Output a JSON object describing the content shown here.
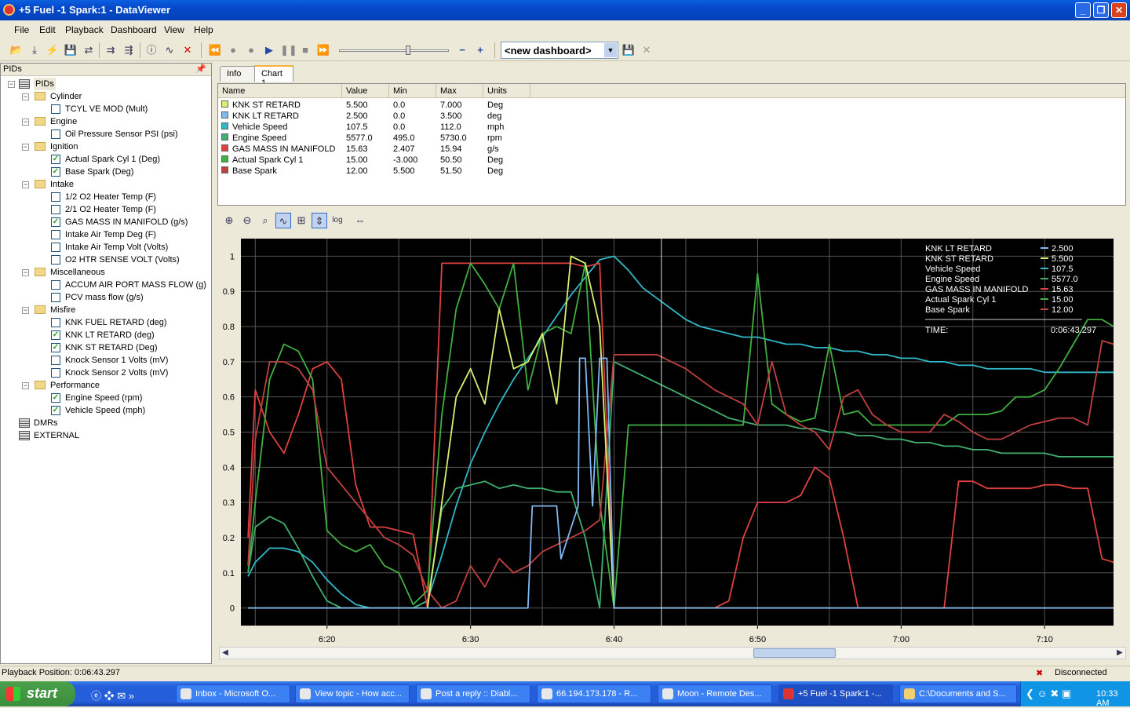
{
  "window": {
    "title": "+5 Fuel -1 Spark:1 - DataViewer"
  },
  "menu": [
    "File",
    "Edit",
    "Playback",
    "Dashboard",
    "View",
    "Help"
  ],
  "toolbar": {
    "dashboard_value": "<new dashboard>"
  },
  "pids_panel": {
    "title": "PIDs",
    "root": "PIDs",
    "groups": [
      {
        "name": "Cylinder",
        "items": [
          {
            "label": "TCYL VE MOD (Mult)",
            "checked": false
          }
        ]
      },
      {
        "name": "Engine",
        "items": [
          {
            "label": "Oil Pressure Sensor PSI (psi)",
            "checked": false
          }
        ]
      },
      {
        "name": "Ignition",
        "items": [
          {
            "label": "Actual Spark Cyl 1 (Deg)",
            "checked": true
          },
          {
            "label": "Base Spark (Deg)",
            "checked": true
          }
        ]
      },
      {
        "name": "Intake",
        "items": [
          {
            "label": "1/2 O2 Heater Temp (F)",
            "checked": false
          },
          {
            "label": "2/1 O2 Heater Temp (F)",
            "checked": false
          },
          {
            "label": "GAS MASS IN MANIFOLD (g/s)",
            "checked": true
          },
          {
            "label": "Intake Air Temp Deg (F)",
            "checked": false
          },
          {
            "label": "Intake Air Temp Volt (Volts)",
            "checked": false
          },
          {
            "label": "O2 HTR SENSE VOLT (Volts)",
            "checked": false
          }
        ]
      },
      {
        "name": "Miscellaneous",
        "items": [
          {
            "label": "ACCUM AIR PORT MASS FLOW (g)",
            "checked": false
          },
          {
            "label": "PCV mass flow (g/s)",
            "checked": false
          }
        ]
      },
      {
        "name": "Misfire",
        "items": [
          {
            "label": "KNK FUEL RETARD (deg)",
            "checked": false
          },
          {
            "label": "KNK LT RETARD (deg)",
            "checked": true
          },
          {
            "label": "KNK ST RETARD (Deg)",
            "checked": true
          },
          {
            "label": "Knock Sensor 1 Volts (mV)",
            "checked": false
          },
          {
            "label": "Knock Sensor 2 Volts (mV)",
            "checked": false
          }
        ]
      },
      {
        "name": "Performance",
        "items": [
          {
            "label": "Engine Speed (rpm)",
            "checked": true
          },
          {
            "label": "Vehicle Speed (mph)",
            "checked": true
          }
        ]
      }
    ],
    "other_roots": [
      "DMRs",
      "EXTERNAL"
    ]
  },
  "tabs": [
    "Info",
    "Chart 1"
  ],
  "table": {
    "columns": [
      "Name",
      "Value",
      "Min",
      "Max",
      "Units"
    ],
    "rows": [
      {
        "name": "KNK ST RETARD",
        "value": "5.500",
        "min": "0.0",
        "max": "7.000",
        "units": "Deg",
        "color": "#d8f070"
      },
      {
        "name": "KNK LT RETARD",
        "value": "2.500",
        "min": "0.0",
        "max": "3.500",
        "units": "deg",
        "color": "#80b8f0"
      },
      {
        "name": "Vehicle Speed",
        "value": "107.5",
        "min": "0.0",
        "max": "112.0",
        "units": "mph",
        "color": "#30b8c8"
      },
      {
        "name": "Engine Speed",
        "value": "5577.0",
        "min": "495.0",
        "max": "5730.0",
        "units": "rpm",
        "color": "#40b070"
      },
      {
        "name": "GAS MASS IN MANIFOLD",
        "value": "15.63",
        "min": "2.407",
        "max": "15.94",
        "units": "g/s",
        "color": "#e04040"
      },
      {
        "name": "Actual Spark Cyl 1",
        "value": "15.00",
        "min": "-3.000",
        "max": "50.50",
        "units": "Deg",
        "color": "#40b040"
      },
      {
        "name": "Base Spark",
        "value": "12.00",
        "min": "5.500",
        "max": "51.50",
        "units": "Deg",
        "color": "#c04040"
      }
    ]
  },
  "chart_data": {
    "type": "line",
    "x_label": "",
    "x_ticks": [
      "6:20",
      "6:30",
      "6:40",
      "6:50",
      "7:00",
      "7:10"
    ],
    "y_ticks": [
      "0",
      "0.1",
      "0.2",
      "0.3",
      "0.4",
      "0.5",
      "0.6",
      "0.7",
      "0.8",
      "0.9",
      "1"
    ],
    "x_range_seconds": [
      374,
      434.8
    ],
    "ylim": [
      -0.05,
      1.05
    ],
    "cursor_time": "0:06:43.297",
    "legend": {
      "position": "top-right",
      "entries": [
        {
          "name": "KNK LT RETARD",
          "value": "2.500"
        },
        {
          "name": "KNK ST RETARD",
          "value": "5.500"
        },
        {
          "name": "Vehicle Speed",
          "value": "107.5"
        },
        {
          "name": "Engine Speed",
          "value": "5577.0"
        },
        {
          "name": "GAS MASS IN MANIFOLD",
          "value": "15.63"
        },
        {
          "name": "Actual Spark Cyl 1",
          "value": "15.00"
        },
        {
          "name": "Base Spark",
          "value": "12.00"
        }
      ],
      "time_label": "TIME:",
      "time_value": "0:06:43.297"
    },
    "series": [
      {
        "name": "Vehicle Speed",
        "color": "#30b8c8",
        "x": [
          374.5,
          375,
          376,
          377,
          378,
          379,
          380,
          381,
          382,
          383,
          384,
          385,
          386,
          387,
          388,
          389,
          390,
          391,
          392,
          393,
          394,
          395,
          396,
          397,
          398,
          399,
          400,
          401,
          402,
          403,
          404,
          405,
          406,
          407,
          408,
          409,
          410,
          411,
          412,
          413,
          414,
          415,
          416,
          417,
          418,
          419,
          420,
          421,
          422,
          423,
          424,
          425,
          426,
          427,
          428,
          429,
          430,
          431,
          432,
          433,
          434,
          434.8
        ],
        "y": [
          0.09,
          0.13,
          0.17,
          0.17,
          0.16,
          0.13,
          0.08,
          0.04,
          0.01,
          0.0,
          0.0,
          0.0,
          0.0,
          0.02,
          0.15,
          0.29,
          0.41,
          0.5,
          0.58,
          0.65,
          0.71,
          0.77,
          0.83,
          0.89,
          0.94,
          0.99,
          1.0,
          0.96,
          0.91,
          0.88,
          0.85,
          0.82,
          0.8,
          0.79,
          0.78,
          0.77,
          0.77,
          0.76,
          0.75,
          0.75,
          0.74,
          0.74,
          0.73,
          0.73,
          0.72,
          0.72,
          0.71,
          0.71,
          0.7,
          0.7,
          0.69,
          0.69,
          0.68,
          0.68,
          0.68,
          0.68,
          0.67,
          0.67,
          0.67,
          0.67,
          0.67,
          0.67
        ]
      },
      {
        "name": "Engine Speed",
        "color": "#40b070",
        "x": [
          374.5,
          375,
          376,
          377,
          378,
          379,
          380,
          381,
          382,
          383,
          384,
          385,
          386,
          387,
          388,
          389,
          390,
          391,
          392,
          393,
          394,
          395,
          396,
          397,
          398,
          399,
          400,
          401,
          402,
          403,
          404,
          405,
          406,
          407,
          408,
          409,
          410,
          411,
          412,
          413,
          414,
          415,
          416,
          417,
          418,
          419,
          420,
          421,
          422,
          423,
          424,
          425,
          426,
          427,
          428,
          429,
          430,
          431,
          432,
          433,
          434,
          434.8
        ],
        "y": [
          0.1,
          0.23,
          0.26,
          0.24,
          0.17,
          0.09,
          0.02,
          0.0,
          0.0,
          0.0,
          0.0,
          0.0,
          0.0,
          0.02,
          0.28,
          0.34,
          0.35,
          0.36,
          0.34,
          0.35,
          0.34,
          0.34,
          0.33,
          0.33,
          0.2,
          0.0,
          0.7,
          0.68,
          0.66,
          0.64,
          0.62,
          0.6,
          0.58,
          0.56,
          0.54,
          0.53,
          0.52,
          0.52,
          0.52,
          0.51,
          0.51,
          0.5,
          0.5,
          0.49,
          0.49,
          0.48,
          0.48,
          0.47,
          0.47,
          0.46,
          0.46,
          0.45,
          0.45,
          0.44,
          0.44,
          0.44,
          0.44,
          0.43,
          0.43,
          0.43,
          0.43,
          0.43
        ]
      },
      {
        "name": "GAS MASS IN MANIFOLD",
        "color": "#e04040",
        "x": [
          374.5,
          375,
          376,
          377,
          378,
          379,
          380,
          381,
          382,
          383,
          384,
          385,
          386,
          387,
          388,
          389,
          390,
          391,
          392,
          393,
          394,
          395,
          396,
          397,
          398,
          399,
          400,
          401,
          402,
          403,
          404,
          405,
          406,
          407,
          408,
          409,
          410,
          411,
          412,
          413,
          414,
          415,
          416,
          417,
          418,
          419,
          420,
          421,
          422,
          423,
          424,
          425,
          426,
          427,
          428,
          429,
          430,
          431,
          432,
          433,
          434,
          434.8
        ],
        "y": [
          0.2,
          0.62,
          0.5,
          0.44,
          0.55,
          0.68,
          0.7,
          0.65,
          0.35,
          0.23,
          0.23,
          0.22,
          0.21,
          0.0,
          0.98,
          0.98,
          0.98,
          0.98,
          0.98,
          0.98,
          0.98,
          0.98,
          0.98,
          0.98,
          0.97,
          0.98,
          0.0,
          0.0,
          0.0,
          0.0,
          0.0,
          0.0,
          0.0,
          0.0,
          0.02,
          0.2,
          0.3,
          0.3,
          0.3,
          0.32,
          0.4,
          0.37,
          0.2,
          0.0,
          0.0,
          0.0,
          0.0,
          0.0,
          0.0,
          0.0,
          0.36,
          0.36,
          0.34,
          0.34,
          0.34,
          0.34,
          0.35,
          0.35,
          0.34,
          0.34,
          0.14,
          0.13
        ]
      },
      {
        "name": "Actual Spark Cyl 1",
        "color": "#40b040",
        "x": [
          374.5,
          375,
          376,
          377,
          378,
          379,
          380,
          381,
          382,
          383,
          384,
          385,
          386,
          387,
          388,
          389,
          390,
          391,
          392,
          393,
          394,
          395,
          396,
          397,
          398,
          399,
          400,
          401,
          402,
          403,
          404,
          405,
          406,
          407,
          408,
          409,
          410,
          411,
          412,
          413,
          414,
          415,
          416,
          417,
          418,
          419,
          420,
          421,
          422,
          423,
          424,
          425,
          426,
          427,
          428,
          429,
          430,
          431,
          432,
          433,
          434,
          434.8
        ],
        "y": [
          0.1,
          0.3,
          0.65,
          0.75,
          0.73,
          0.65,
          0.22,
          0.18,
          0.16,
          0.18,
          0.12,
          0.1,
          0.01,
          0.05,
          0.55,
          0.85,
          0.98,
          0.92,
          0.85,
          0.98,
          0.62,
          0.78,
          0.8,
          0.78,
          0.98,
          0.3,
          0.0,
          0.52,
          0.52,
          0.52,
          0.52,
          0.52,
          0.52,
          0.52,
          0.52,
          0.52,
          0.95,
          0.58,
          0.55,
          0.53,
          0.54,
          0.75,
          0.55,
          0.56,
          0.52,
          0.52,
          0.52,
          0.52,
          0.52,
          0.52,
          0.55,
          0.55,
          0.55,
          0.56,
          0.6,
          0.6,
          0.62,
          0.68,
          0.75,
          0.82,
          0.82,
          0.8
        ]
      },
      {
        "name": "Base Spark",
        "color": "#c04040",
        "x": [
          374.5,
          375,
          376,
          377,
          378,
          379,
          380,
          381,
          382,
          383,
          384,
          385,
          386,
          387,
          388,
          389,
          390,
          391,
          392,
          393,
          394,
          395,
          396,
          397,
          398,
          399,
          400,
          401,
          402,
          403,
          404,
          405,
          406,
          407,
          408,
          409,
          410,
          411,
          412,
          413,
          414,
          415,
          416,
          417,
          418,
          419,
          420,
          421,
          422,
          423,
          424,
          425,
          426,
          427,
          428,
          429,
          430,
          431,
          432,
          433,
          434,
          434.8
        ],
        "y": [
          0.12,
          0.48,
          0.7,
          0.7,
          0.68,
          0.62,
          0.4,
          0.35,
          0.3,
          0.25,
          0.2,
          0.18,
          0.15,
          0.05,
          0.0,
          0.02,
          0.12,
          0.06,
          0.14,
          0.1,
          0.12,
          0.16,
          0.18,
          0.2,
          0.22,
          0.25,
          0.72,
          0.72,
          0.72,
          0.72,
          0.7,
          0.68,
          0.65,
          0.62,
          0.6,
          0.58,
          0.52,
          0.7,
          0.55,
          0.52,
          0.5,
          0.45,
          0.6,
          0.62,
          0.55,
          0.52,
          0.5,
          0.5,
          0.5,
          0.55,
          0.53,
          0.5,
          0.48,
          0.48,
          0.5,
          0.52,
          0.53,
          0.54,
          0.54,
          0.52,
          0.76,
          0.75
        ]
      },
      {
        "name": "KNK ST RETARD",
        "color": "#d8f070",
        "x": [
          374.5,
          383,
          384,
          385,
          386,
          386.5,
          387,
          388,
          389,
          390,
          391,
          392,
          393,
          394,
          395,
          396,
          397,
          398,
          399,
          400,
          434.8
        ],
        "y": [
          0.0,
          0.0,
          0.0,
          0.0,
          0.0,
          0.0,
          0.0,
          0.3,
          0.6,
          0.68,
          0.58,
          0.85,
          0.68,
          0.7,
          0.78,
          0.58,
          1.0,
          0.98,
          0.8,
          0.0,
          0.0
        ]
      },
      {
        "name": "KNK LT RETARD",
        "color": "#80b8f0",
        "x": [
          374.5,
          394,
          394.3,
          396,
          396.3,
          397.5,
          397.6,
          398,
          398.5,
          399,
          399.5,
          400,
          434.8
        ],
        "y": [
          0.0,
          0.0,
          0.29,
          0.29,
          0.14,
          0.29,
          0.71,
          0.71,
          0.29,
          0.71,
          0.71,
          0.0,
          0.0
        ]
      }
    ]
  },
  "status": {
    "playback": "Playback Position: 0:06:43.297",
    "connection": "Disconnected"
  },
  "taskbar": {
    "start_label": "start",
    "tasks": [
      "Inbox - Microsoft O...",
      "View topic - How acc...",
      "Post a reply :: Diabl...",
      "66.194.173.178 - R...",
      "Moon - Remote Des...",
      "+5 Fuel -1 Spark:1 -...",
      "C:\\Documents and S..."
    ],
    "clock": "10:33 AM"
  }
}
